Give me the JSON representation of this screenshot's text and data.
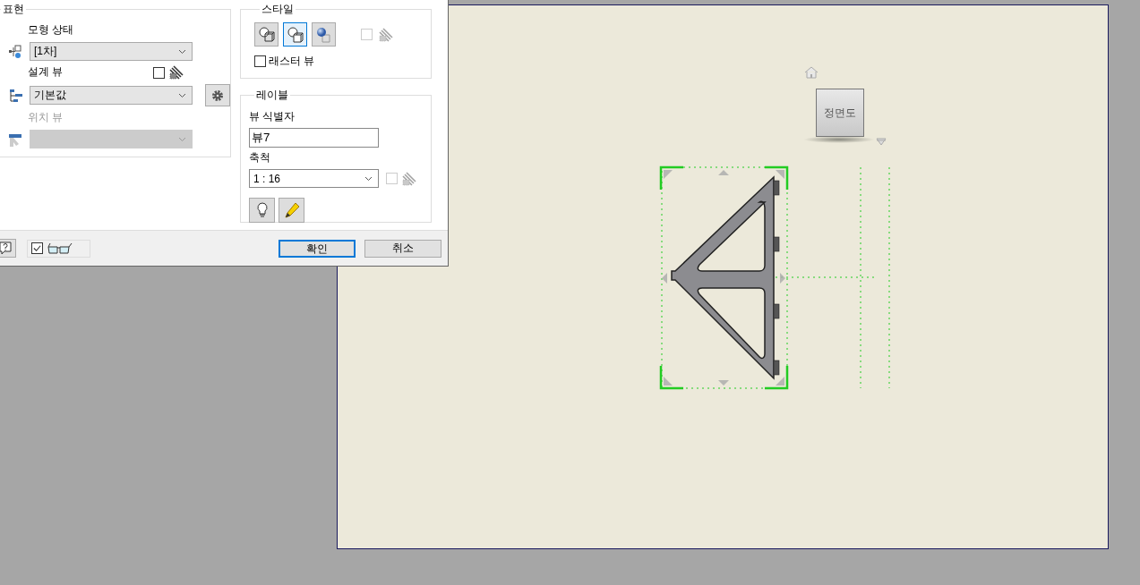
{
  "dialog": {
    "appearance": {
      "title": "표현",
      "model_state": {
        "label": "모형 상태",
        "value": "[1차]"
      },
      "design_view": {
        "label": "설계 뷰",
        "value": "기본값",
        "associative": false
      },
      "positional_view": {
        "label": "위치 뷰",
        "disabled": true
      }
    },
    "style": {
      "title": "스타일",
      "buttons": [
        {
          "kind": "hidden-lines",
          "selected": false
        },
        {
          "kind": "hidden-removed",
          "selected": true
        },
        {
          "kind": "shaded",
          "selected": false
        }
      ],
      "style_from_base": {
        "checked": false,
        "disabled": true
      },
      "raster_view": {
        "label": "래스터 뷰",
        "checked": false
      }
    },
    "label": {
      "title": "레이블",
      "view_identifier": {
        "label": "뷰 식별자",
        "value": "뷰7"
      },
      "scale": {
        "label": "축척",
        "value": "1 : 16"
      },
      "scale_from_base": {
        "checked": false,
        "disabled": true
      }
    },
    "bottom": {
      "preview": {
        "checked": true
      },
      "ok": "확인",
      "cancel": "취소"
    }
  },
  "viewcube": {
    "face": "정면도"
  }
}
